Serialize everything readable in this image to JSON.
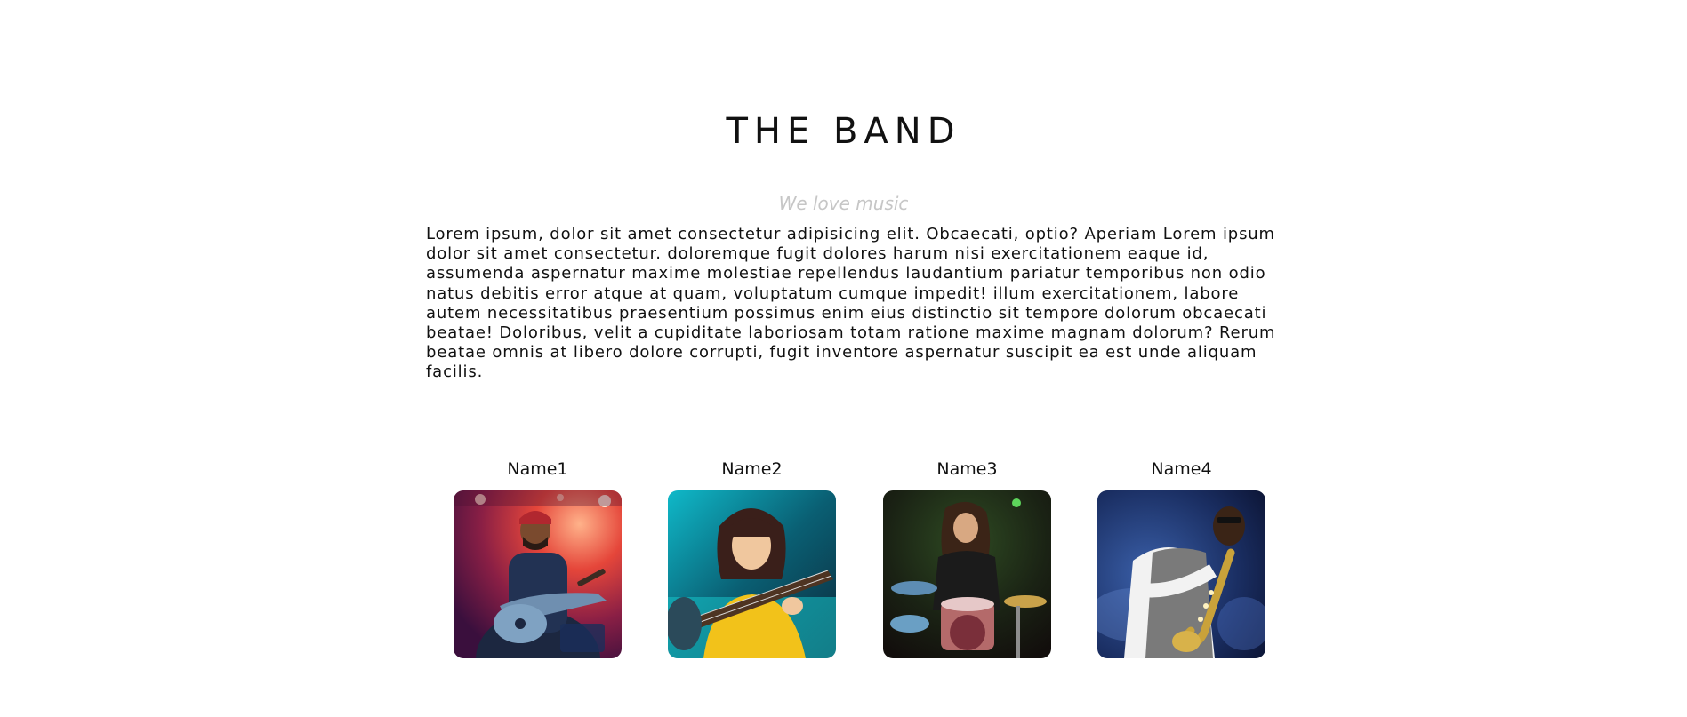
{
  "band": {
    "title": "THE BAND",
    "tagline": "We love music",
    "description": "Lorem ipsum, dolor sit amet consectetur adipisicing elit. Obcaecati, optio? Aperiam Lorem ipsum dolor sit amet consectetur. doloremque fugit dolores harum nisi exercitationem eaque id, assumenda aspernatur maxime molestiae repellendus laudantium pariatur temporibus non odio natus debitis error atque at quam, voluptatum cumque impedit! illum exercitationem, labore autem necessitatibus praesentium possimus enim eius distinctio sit tempore dolorum obcaecati beatae! Doloribus, velit a cupiditate laboriosam totam ratione maxime magnam dolorum? Rerum beatae omnis at libero dolore corrupti, fugit inventore aspernatur suscipit ea est unde aliquam facilis."
  },
  "members": [
    {
      "name": "Name1",
      "photo_icon": "guitarist-photo"
    },
    {
      "name": "Name2",
      "photo_icon": "guitar-player-woman-photo"
    },
    {
      "name": "Name3",
      "photo_icon": "drummer-photo"
    },
    {
      "name": "Name4",
      "photo_icon": "saxophonist-photo"
    }
  ],
  "colors": {
    "text": "#111111",
    "tagline": "#c6c6c6",
    "background": "#ffffff"
  }
}
